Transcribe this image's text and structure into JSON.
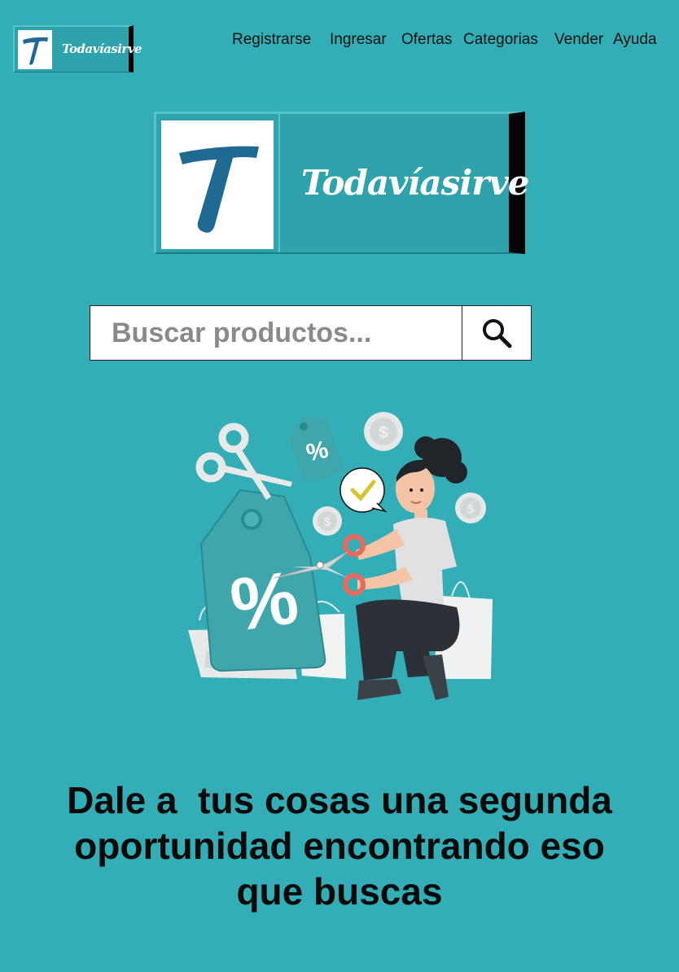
{
  "header": {
    "logo_text": "Todavíasirve",
    "nav": [
      {
        "label": "Registrarse"
      },
      {
        "label": "Ingresar"
      },
      {
        "label": "Ofertas"
      },
      {
        "label": "Categorias"
      },
      {
        "label": "Vender"
      },
      {
        "label": "Ayuda"
      }
    ]
  },
  "hero": {
    "logo_text": "Todavíasirve",
    "logo_letter": "T"
  },
  "search": {
    "placeholder": "Buscar productos...",
    "value": "",
    "button_icon": "search-icon"
  },
  "illustration": {
    "tag_symbol": "%",
    "small_tag_symbol": "%",
    "coin_symbol": "$"
  },
  "tagline": {
    "line1": "Dale a  tus cosas una segunda",
    "line2": "oportunidad encontrando eso",
    "line3": "que buscas"
  },
  "colors": {
    "background": "#33aeb6",
    "logo_letter": "#1e6a93",
    "text": "#0a0a0a"
  }
}
